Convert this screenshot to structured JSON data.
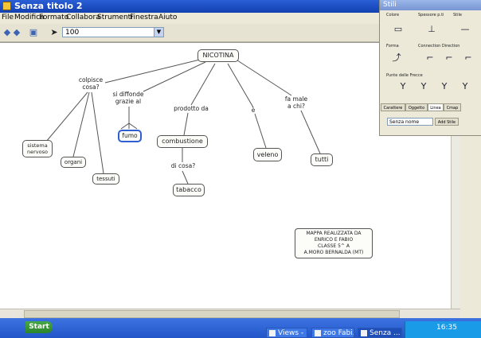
{
  "window": {
    "title": "Senza titolo 2"
  },
  "menu": {
    "items": [
      "File",
      "Modifica",
      "Formato",
      "Collabora",
      "Strumenti",
      "Finestra",
      "Aiuto"
    ]
  },
  "toolbar": {
    "zoom": "100"
  },
  "stili": {
    "title": "Stili",
    "labels": {
      "colore": "Colore",
      "spessore": "Spessore p.ti",
      "stile": "Stile",
      "forma": "Forma",
      "connection": "Connection Direction",
      "punte": "Punte delle Frecce"
    },
    "tabs": [
      "Carattere",
      "Oggetto",
      "Linea",
      "Cmap"
    ],
    "selected_tab": "Linea",
    "input_value": "Senza nome",
    "add_button": "Add Stile"
  },
  "map": {
    "root": "NICOTINA",
    "links": {
      "colpisce": "colpisce\ncosa?",
      "si_diffonde": "si diffonde\ngrazie al",
      "prodotto_da": "prodotto da",
      "e": "è",
      "fa_male": "fa male\na chi?",
      "di_cosa": "di cosa?"
    },
    "concepts": {
      "sistema": "sistema\nnervoso",
      "organi": "organi",
      "tessuti": "tessuti",
      "fumo": "fumo",
      "combustione": "combustione",
      "tabacco": "tabacco",
      "veleno": "veleno",
      "tutti": "tutti"
    },
    "credits": [
      "MAPPA  REALIZZATA DA",
      "ENRICO E FABIO",
      "CLASSE 5^ A",
      "A.MORO BERNALDA (MT)"
    ]
  },
  "taskbar": {
    "start": "Start",
    "tasks": [
      {
        "label": "Views -",
        "active": false
      },
      {
        "label": "zoo Fabi...",
        "active": false
      },
      {
        "label": "Senza ...",
        "active": true
      }
    ],
    "clock": "16:35"
  }
}
